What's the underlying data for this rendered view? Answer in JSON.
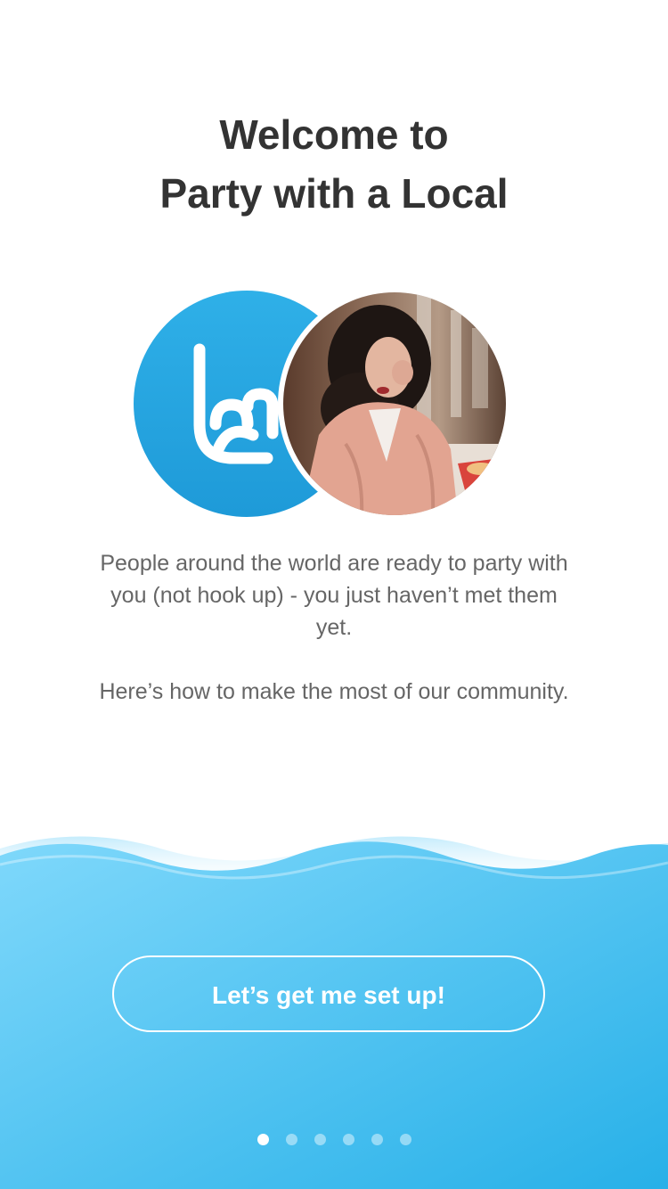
{
  "title": {
    "line1": "Welcome to",
    "line2": "Party with a Local"
  },
  "hero": {
    "logo_icon": "rock-hand-icon",
    "photo": "member-photo"
  },
  "description": {
    "paragraph1": "People around the world are ready to party with you (not hook up) - you just haven’t met them yet.",
    "paragraph2": "Here’s how to make the most of our community."
  },
  "cta": {
    "label": "Let’s get me set up!"
  },
  "pagination": {
    "total": 6,
    "current": 1
  },
  "colors": {
    "brand_blue": "#23a6e2",
    "wave_light": "#7fd8fb",
    "wave_dark": "#2db4ea",
    "title_text": "#333333",
    "body_text": "#666666"
  }
}
